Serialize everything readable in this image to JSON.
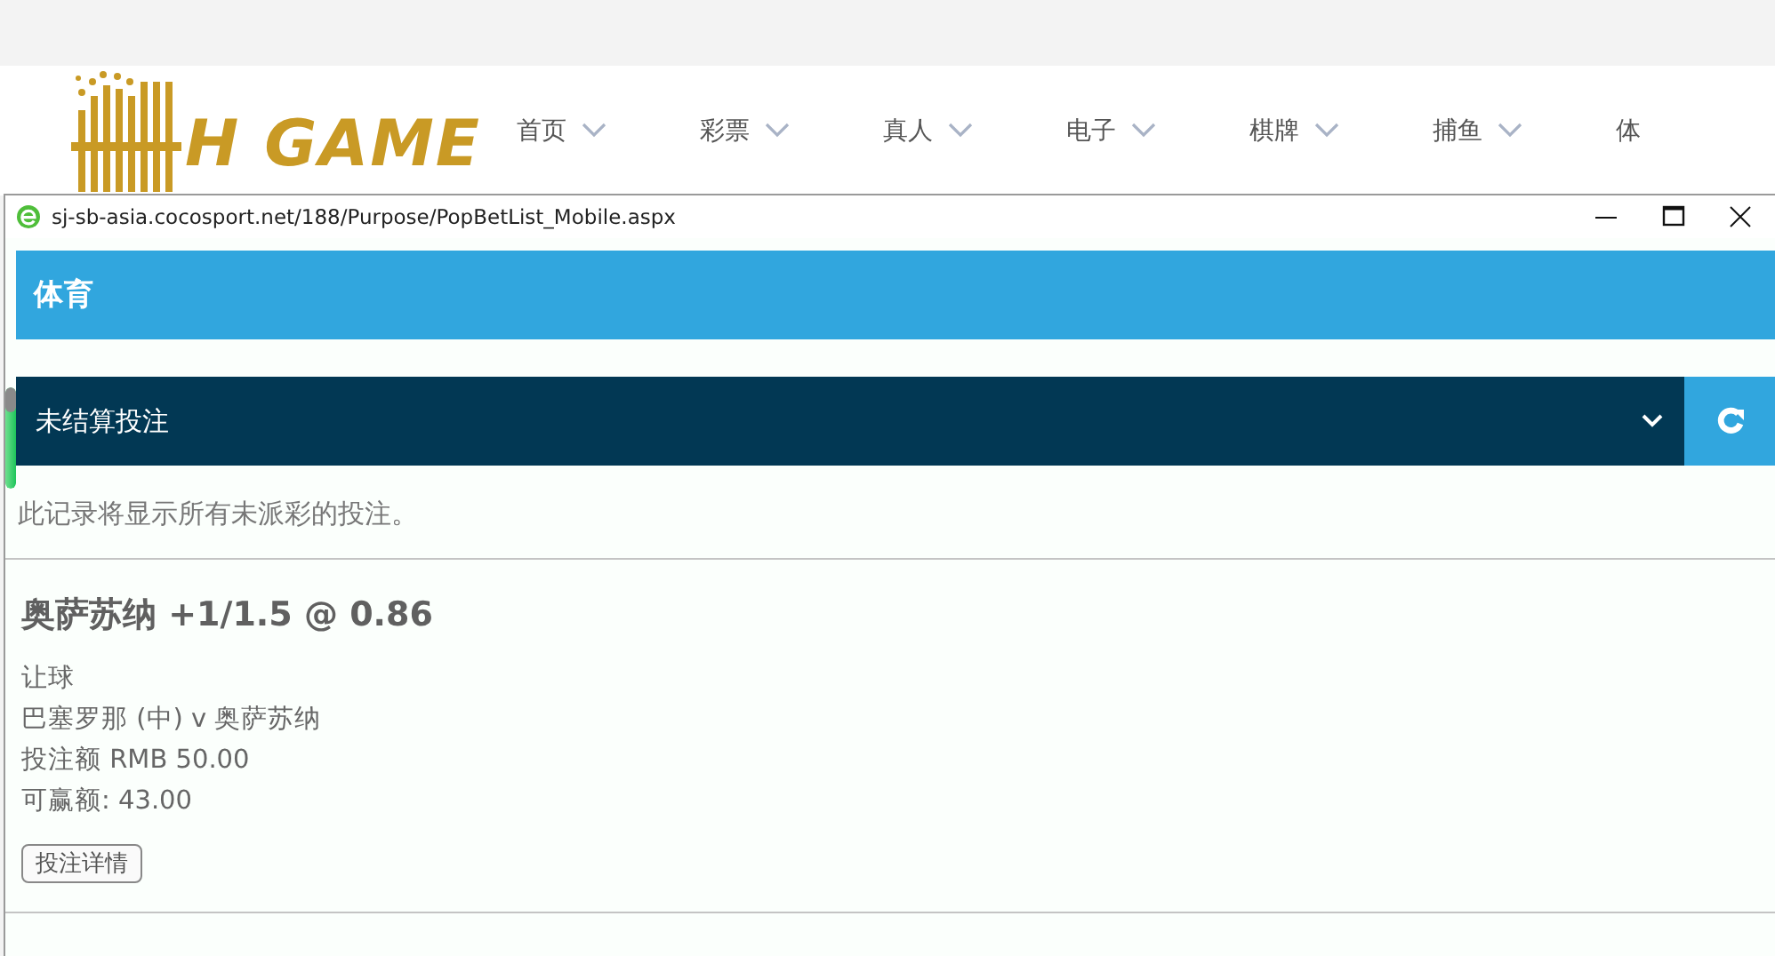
{
  "site_header": {
    "logo": "H GAME",
    "nav": [
      {
        "label": "首页",
        "chevron": true
      },
      {
        "label": "彩票",
        "chevron": true
      },
      {
        "label": "真人",
        "chevron": true
      },
      {
        "label": "电子",
        "chevron": true
      },
      {
        "label": "棋牌",
        "chevron": true
      },
      {
        "label": "捕鱼",
        "chevron": true
      },
      {
        "label": "体",
        "chevron": false
      }
    ]
  },
  "popup": {
    "url": "sj-sb-asia.cocosport.net/188/Purpose/PopBetList_Mobile.aspx",
    "section_title": "体育",
    "filter": {
      "value": "未结算投注"
    },
    "notice": "此记录将显示所有未派彩的投注。",
    "bets": [
      {
        "title": "奥萨苏纳 +1/1.5 @ 0.86",
        "market": "让球",
        "match": "巴塞罗那 (中) v 奥萨苏纳",
        "stake": "投注额 RMB 50.00",
        "potential_win": "可赢额: 43.00",
        "details_button": "投注详情"
      }
    ]
  }
}
